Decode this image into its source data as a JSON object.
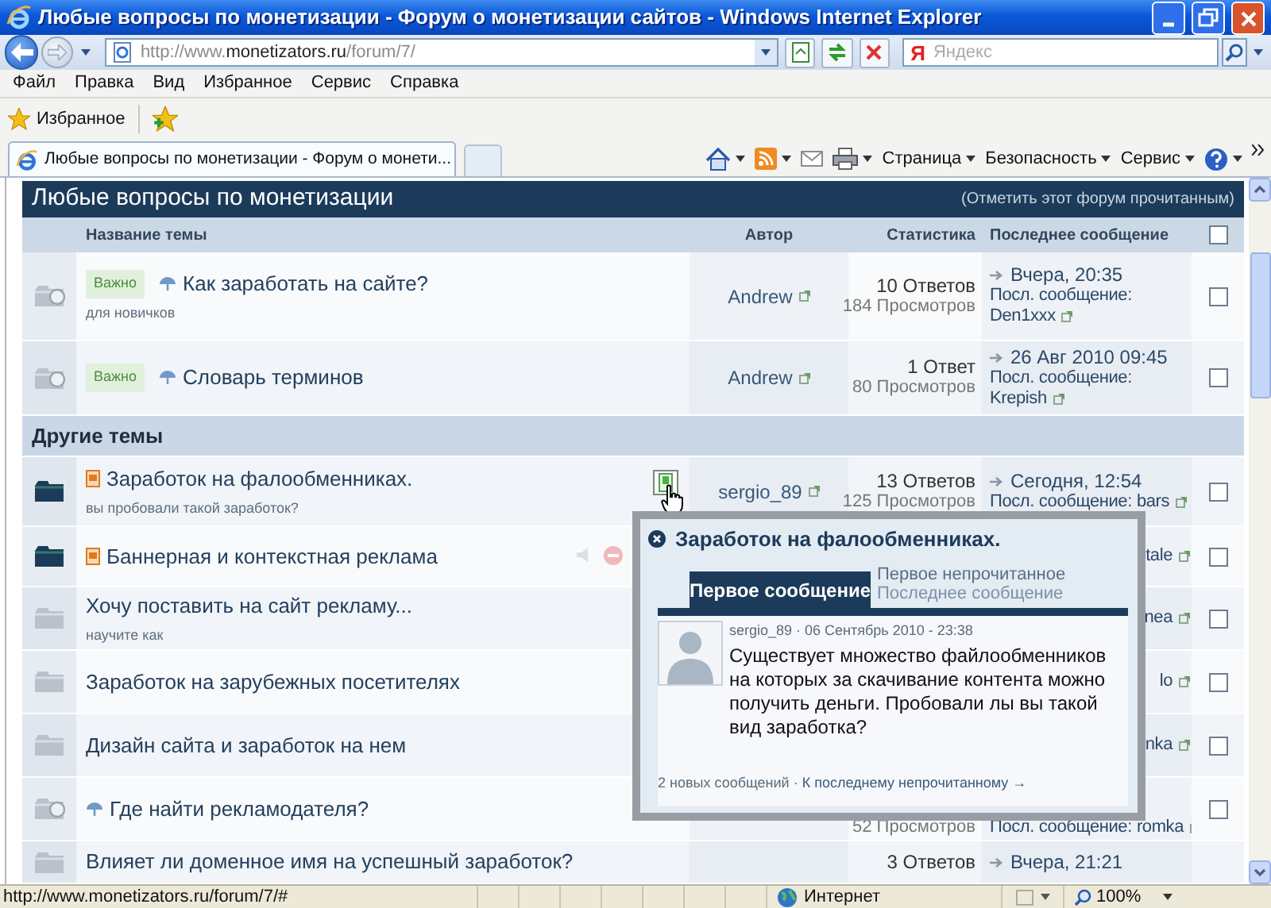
{
  "window": {
    "title": "Любые вопросы по монетизации - Форум о монетизации сайтов - Windows Internet Explorer"
  },
  "address_bar": {
    "url_prefix": "http://www.",
    "url_domain": "monetizators.ru",
    "url_path": "/forum/7/"
  },
  "search": {
    "logo": "Я",
    "placeholder": "Яндекс"
  },
  "menu": [
    "Файл",
    "Правка",
    "Вид",
    "Избранное",
    "Сервис",
    "Справка"
  ],
  "favorites": {
    "label": "Избранное"
  },
  "tabs": [
    {
      "label": "Любые вопросы по монетизации - Форум о монети...",
      "selected": true
    }
  ],
  "command_bar": [
    "Страница",
    "Безопасность",
    "Сервис"
  ],
  "forum": {
    "title": "Любые вопросы по монетизации",
    "mark_read": "(Отметить этот форум прочитанным)",
    "columns": [
      "Название темы",
      "Автор",
      "Статистика",
      "Последнее сообщение"
    ],
    "select_all_checked": false,
    "rows": [
      {
        "kind": "topic",
        "unread": false,
        "ringed": true,
        "badge": "Важно",
        "prefix": {
          "kind": "umbrella"
        },
        "title": "Как заработать на сайте?",
        "subtitle": "для новичков",
        "hovered": false,
        "quick_icons": false,
        "author": "Andrew",
        "replies": "10 Ответов",
        "views": "184 Просмотров",
        "last_date": "Вчера, 20:35",
        "last_label": "Посл. сообщение:",
        "last_author": "Den1xxx",
        "checked": false
      },
      {
        "kind": "topic",
        "unread": false,
        "ringed": true,
        "badge": "Важно",
        "prefix": {
          "kind": "umbrella"
        },
        "title": "Словарь терминов",
        "hovered": false,
        "quick_icons": false,
        "author": "Andrew",
        "replies": "1 Ответ",
        "views": "80 Просмотров",
        "last_date": "26 Авг 2010 09:45",
        "last_label": "Посл. сообщение:",
        "last_author": "Krepish",
        "checked": false
      },
      {
        "kind": "section",
        "title": "Другие темы"
      },
      {
        "kind": "topic",
        "unread": true,
        "ringed": false,
        "prefix": {
          "kind": "document"
        },
        "title": "Заработок на фалообменниках.",
        "subtitle": "вы пробовали такой заработок?",
        "hovered": true,
        "quick_icons": false,
        "author": "sergio_89",
        "replies": "13 Ответов",
        "views": "125 Просмотров",
        "last_date": "Сегодня, 12:54",
        "last_label": "Посл. сообщение:",
        "last_author": "bars",
        "checked": false
      },
      {
        "kind": "topic",
        "unread": true,
        "ringed": false,
        "prefix": {
          "kind": "document"
        },
        "title": "Баннерная и контекстная реклама",
        "hovered": false,
        "quick_icons": true,
        "last_author": "tale",
        "checked": false
      },
      {
        "kind": "topic",
        "unread": false,
        "ringed": false,
        "title": "Хочу поставить на сайт рекламу...",
        "subtitle": "научите как",
        "hovered": false,
        "quick_icons": false,
        "last_author": "nea",
        "checked": false
      },
      {
        "kind": "topic",
        "unread": false,
        "ringed": false,
        "title": "Заработок на зарубежных посетителях",
        "hovered": false,
        "quick_icons": false,
        "last_author": "lo",
        "checked": false
      },
      {
        "kind": "topic",
        "unread": false,
        "ringed": false,
        "title": "Дизайн сайта и заработок на нем",
        "hovered": false,
        "quick_icons": false,
        "last_author": "nka",
        "checked": false
      },
      {
        "kind": "topic",
        "unread": false,
        "ringed": true,
        "prefix": {
          "kind": "umbrella"
        },
        "title": "Где найти рекламодателя?",
        "hovered": false,
        "quick_icons": false,
        "views": "52 Просмотров",
        "last_label": "Посл. сообщение:",
        "last_author": "romka",
        "checked": false
      },
      {
        "kind": "topic",
        "unread": false,
        "ringed": false,
        "title": "Влияет ли доменное имя на успешный заработок?",
        "hovered": false,
        "quick_icons": false,
        "replies": "3 Ответов",
        "last_date": "Вчера, 21:21"
      }
    ]
  },
  "popup": {
    "title": "Заработок на фалообменниках.",
    "tabs": [
      {
        "label": "Первое сообщение",
        "selected": true
      },
      {
        "label": "Первое непрочитанное",
        "selected": false
      },
      {
        "label": "Последнее сообщение",
        "selected": false
      }
    ],
    "meta": "sergio_89 · 06 Сентябрь 2010 - 23:38",
    "text": "Существует множество файлообменников на которых за скачивание контента можно получить деньги. Пробовали лы вы такой вид заработка?",
    "footer": "2 новых сообщений ·",
    "footer_link": "К последнему непрочитанному →"
  },
  "status_bar": {
    "url": "http://www.monetizators.ru/forum/7/#",
    "zone": "Интернет",
    "zoom": "100%"
  }
}
